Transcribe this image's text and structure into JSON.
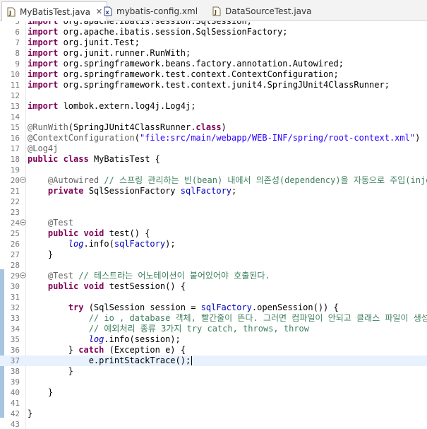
{
  "tabs": [
    {
      "label": "MyBatisTest.java",
      "icon": "java-file-icon",
      "active": true,
      "close": "✕"
    },
    {
      "label": "mybatis-config.xml",
      "icon": "xml-file-icon",
      "active": false
    },
    {
      "label": "DataSourceTest.java",
      "icon": "java-file-icon",
      "active": false
    }
  ],
  "lines": [
    {
      "n": "5",
      "html": "<span class=\"kw\">import</span> org.apache.ibatis.session.SqlSession;"
    },
    {
      "n": "6",
      "html": "<span class=\"kw\">import</span> org.apache.ibatis.session.SqlSessionFactory;"
    },
    {
      "n": "7",
      "html": "<span class=\"kw\">import</span> org.junit.Test;"
    },
    {
      "n": "8",
      "html": "<span class=\"kw\">import</span> org.junit.runner.RunWith;"
    },
    {
      "n": "9",
      "html": "<span class=\"kw\">import</span> org.springframework.beans.factory.annotation.Autowired;"
    },
    {
      "n": "10",
      "html": "<span class=\"kw\">import</span> org.springframework.test.context.ContextConfiguration;"
    },
    {
      "n": "11",
      "html": "<span class=\"kw\">import</span> org.springframework.test.context.junit4.SpringJUnit4ClassRunner;"
    },
    {
      "n": "12",
      "html": ""
    },
    {
      "n": "13",
      "html": "<span class=\"kw\">import</span> lombok.extern.log4j.Log4j;"
    },
    {
      "n": "14",
      "html": ""
    },
    {
      "n": "15",
      "html": "<span class=\"an\">@RunWith</span>(SpringJUnit4ClassRunner.<span class=\"kw\">class</span>)"
    },
    {
      "n": "16",
      "html": "<span class=\"an\">@ContextConfiguration</span>(<span class=\"str\">\"file:src/main/webapp/WEB-INF/spring/root-context.xml\"</span>)"
    },
    {
      "n": "17",
      "html": "<span class=\"an\">@Log4j</span>"
    },
    {
      "n": "18",
      "html": "<span class=\"kw\">public</span> <span class=\"kw\">class</span> MyBatisTest {"
    },
    {
      "n": "19",
      "html": ""
    },
    {
      "n": "20",
      "fold": true,
      "html": "    <span class=\"an\">@Autowired</span> <span class=\"cm\">// 스프링 관리하는 빈(bean) 내에서 의존성(dependency)을 자동으로 주입(injection)</span>"
    },
    {
      "n": "21",
      "html": "    <span class=\"kw\">private</span> SqlSessionFactory <span class=\"fld\">sqlFactory</span>;"
    },
    {
      "n": "22",
      "html": ""
    },
    {
      "n": "23",
      "html": ""
    },
    {
      "n": "24",
      "fold": true,
      "html": "    <span class=\"an\">@Test</span>"
    },
    {
      "n": "25",
      "html": "    <span class=\"kw\">public</span> <span class=\"kw\">void</span> test() {"
    },
    {
      "n": "26",
      "html": "        <span class=\"sfld\">log</span>.info(<span class=\"fld\">sqlFactory</span>);"
    },
    {
      "n": "27",
      "html": "    }"
    },
    {
      "n": "28",
      "html": ""
    },
    {
      "n": "29",
      "fold": true,
      "html": "    <span class=\"an\">@Test</span> <span class=\"cm\">// 테스트라는 어노테이션이 붙어있어야 호출된다.</span>"
    },
    {
      "n": "30",
      "html": "    <span class=\"kw\">public</span> <span class=\"kw\">void</span> testSession() {"
    },
    {
      "n": "31",
      "html": ""
    },
    {
      "n": "32",
      "html": "        <span class=\"kw\">try</span> (SqlSession session = <span class=\"fld\">sqlFactory</span>.openSession()) {"
    },
    {
      "n": "33",
      "html": "            <span class=\"cm\">// io , database 객체, 빨간줄이 뜬다. 그러면 컴파일이 안되고 클래스 파일이 생성이 안</span>"
    },
    {
      "n": "34",
      "html": "            <span class=\"cm\">// 예외처리 종류 3가지 try catch, throws, throw</span>"
    },
    {
      "n": "35",
      "html": "            <span class=\"sfld\">log</span>.info(session);"
    },
    {
      "n": "36",
      "html": "        } <span class=\"kw\">catch</span> (Exception e) {"
    },
    {
      "n": "37",
      "current": true,
      "html": "            e.printStackTrace();<span class=\"cursor\"></span>"
    },
    {
      "n": "38",
      "html": "        }"
    },
    {
      "n": "39",
      "html": ""
    },
    {
      "n": "40",
      "html": "    }"
    },
    {
      "n": "41",
      "html": ""
    },
    {
      "n": "42",
      "html": "}"
    },
    {
      "n": "43",
      "html": ""
    }
  ],
  "colors": {
    "keyword": "#7f0055",
    "annotation": "#646464",
    "string": "#2a00ff",
    "comment": "#3f7f5f",
    "field": "#0000c0",
    "current_line": "#e8f2fe"
  }
}
